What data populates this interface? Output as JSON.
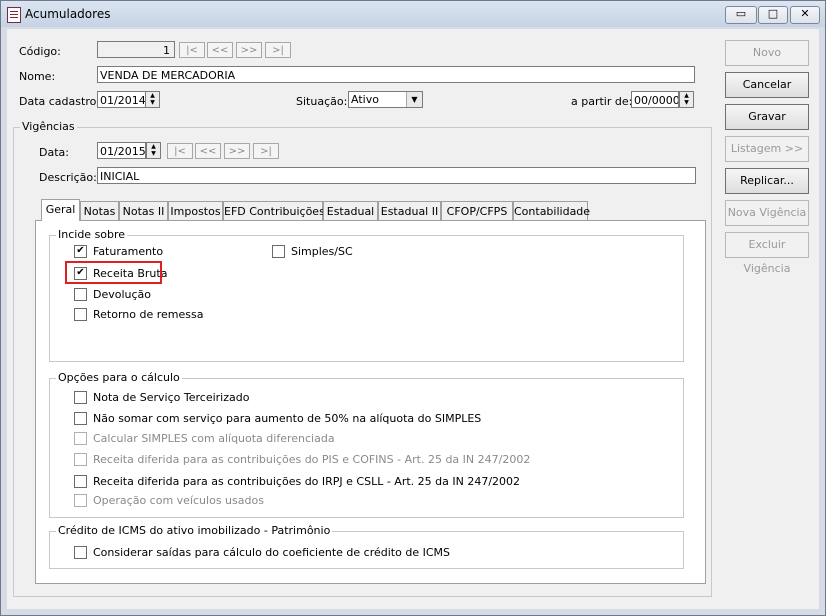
{
  "window": {
    "title": "Acumuladores",
    "min_glyph": "▭",
    "max_glyph": "□",
    "close_glyph": "✕"
  },
  "header": {
    "codigo_label": "Código:",
    "codigo_value": "1",
    "nav": [
      "|<",
      "<<",
      ">>",
      ">|"
    ],
    "nome_label": "Nome:",
    "nome_value": "VENDA DE MERCADORIA",
    "data_cadastro_label": "Data cadastro:",
    "data_cadastro_value": "01/2014",
    "situacao_label": "Situação:",
    "situacao_value": "Ativo",
    "a_partir_label": "a partir de:",
    "a_partir_value": "00/0000"
  },
  "vigencias": {
    "title": "Vigências",
    "data_label": "Data:",
    "data_value": "01/2015",
    "descricao_label": "Descrição:",
    "descricao_value": "INICIAL"
  },
  "tabs": [
    "Geral",
    "Notas",
    "Notas II",
    "Impostos",
    "EFD Contribuições",
    "Estadual",
    "Estadual II",
    "CFOP/CFPS",
    "Contabilidade"
  ],
  "incide_sobre": {
    "title": "Incide sobre",
    "items": [
      {
        "label": "Faturamento",
        "checked": true
      },
      {
        "label": "Receita Bruta",
        "checked": true
      },
      {
        "label": "Devolução",
        "checked": false
      },
      {
        "label": "Retorno de remessa",
        "checked": false
      },
      {
        "label": "Simples/SC",
        "checked": false
      }
    ]
  },
  "opcoes_calculo": {
    "title": "Opções para o cálculo",
    "items": [
      {
        "label": "Nota de Serviço Terceirizado",
        "checked": false,
        "enabled": true
      },
      {
        "label": "Não somar com serviço para aumento de 50% na alíquota do SIMPLES",
        "checked": false,
        "enabled": true
      },
      {
        "label": "Calcular SIMPLES com alíquota diferenciada",
        "checked": false,
        "enabled": false
      },
      {
        "label": "Receita diferida para as contribuições do PIS e COFINS - Art. 25 da IN 247/2002",
        "checked": false,
        "enabled": false
      },
      {
        "label": "Receita diferida para as contribuições do IRPJ e CSLL - Art. 25 da IN 247/2002",
        "checked": false,
        "enabled": true
      },
      {
        "label": "Operação com veículos usados",
        "checked": false,
        "enabled": false
      }
    ]
  },
  "credito_icms": {
    "title": "Crédito de ICMS do ativo imobilizado - Patrimônio",
    "items": [
      {
        "label": "Considerar saídas para cálculo do coeficiente de crédito de ICMS",
        "checked": false
      }
    ]
  },
  "buttons": {
    "novo": "Novo",
    "cancelar": "Cancelar",
    "gravar": "Gravar",
    "listagem": "Listagem >>",
    "replicar": "Replicar...",
    "nova_vigencia": "Nova Vigência",
    "excluir_vigencia": "Excluir Vigência"
  },
  "check_glyph": "✔"
}
